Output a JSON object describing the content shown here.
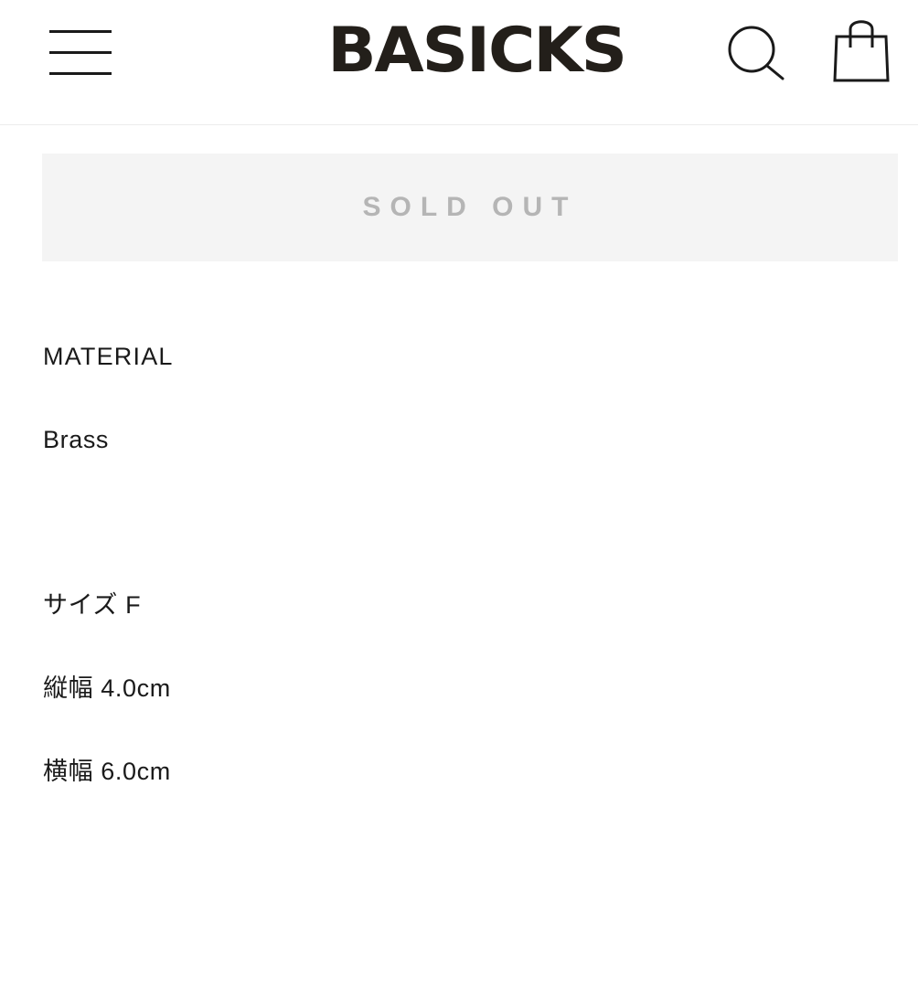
{
  "header": {
    "logo_text": "BASICKS",
    "menu_icon": "hamburger-menu-icon",
    "search_icon": "search-icon",
    "cart_icon": "shopping-bag-icon"
  },
  "product": {
    "sold_out_label": "SOLD OUT",
    "material_label": "MATERIAL",
    "material_value": "Brass",
    "size_line": "サイズ F",
    "height_line": "縦幅 4.0cm",
    "width_line": "横幅 6.0cm"
  },
  "colors": {
    "text": "#1a1a1a",
    "logo": "#231f1a",
    "sold_out_bg": "#f4f4f4",
    "sold_out_text": "#b5b5b5",
    "divider": "#ececec"
  }
}
